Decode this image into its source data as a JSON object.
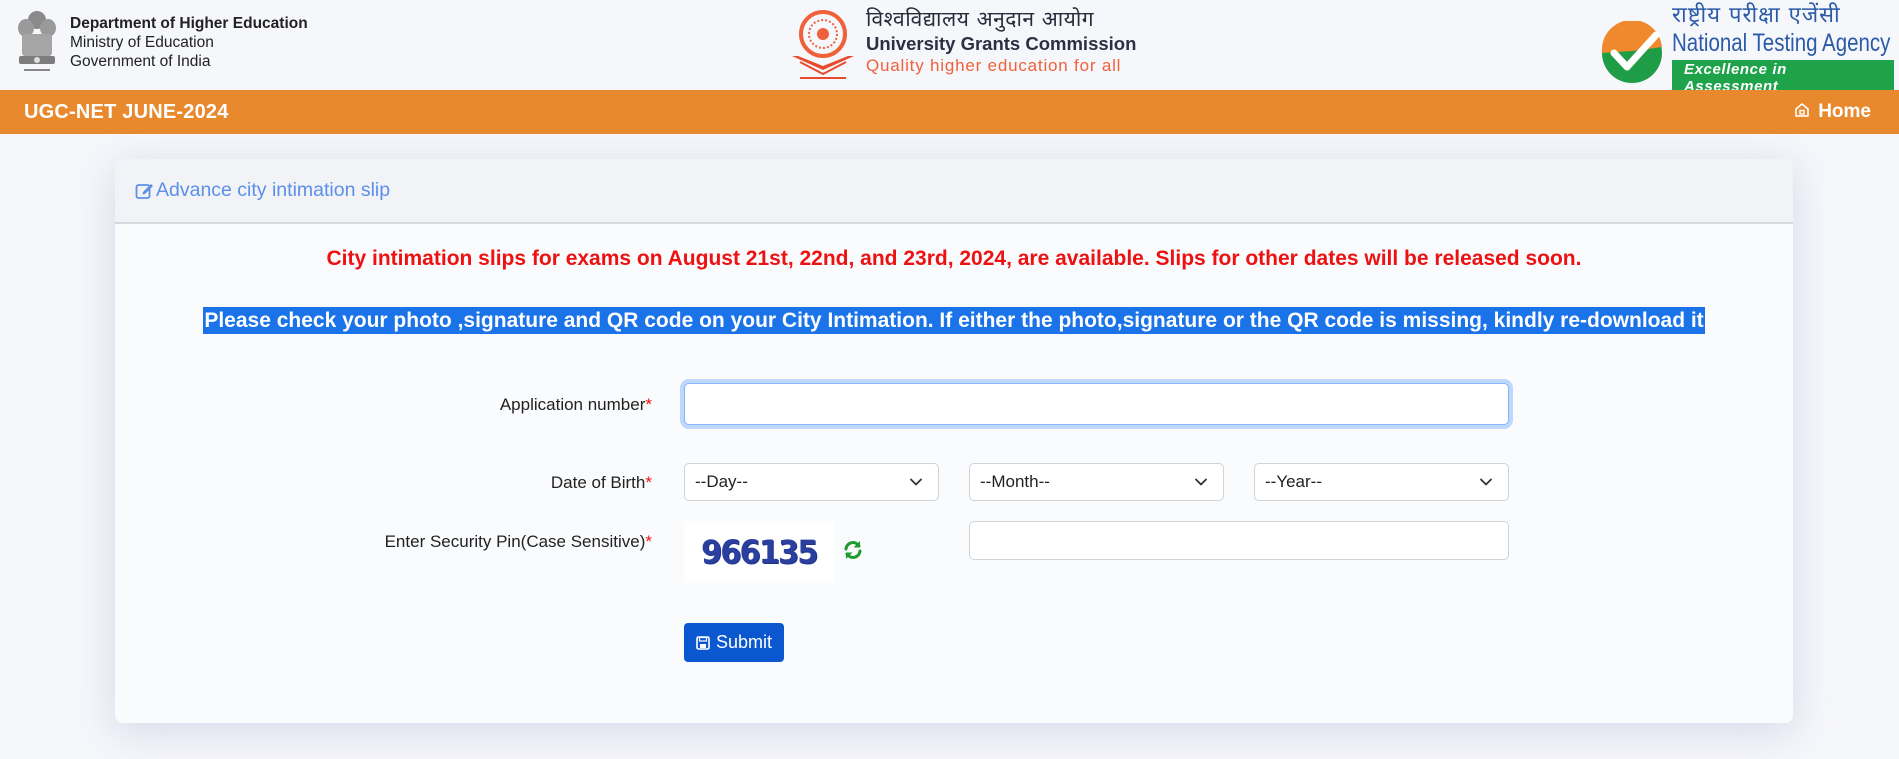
{
  "header": {
    "ministry": {
      "line1": "Department of Higher Education",
      "line2": "Ministry of Education",
      "line3": "Government of India",
      "emblem_icon": "ashoka-emblem-icon"
    },
    "ugc": {
      "hindi": "विश्वविद्यालय अनुदान आयोग",
      "english": "University Grants Commission",
      "tagline": "Quality higher education for all",
      "logo_icon": "ugc-chakra-logo-icon",
      "brand_color": "#f0613a"
    },
    "nta": {
      "hindi": "राष्ट्रीय परीक्षा एजेंसी",
      "english": "National Testing Agency",
      "tagline": "Excellence in Assessment",
      "logo_icon": "nta-check-logo-icon",
      "brand_color": "#2a5aa8",
      "tagline_color": "#1ea24a"
    }
  },
  "navbar": {
    "brand": "UGC-NET JUNE-2024",
    "home_label": "Home",
    "home_icon": "home-icon",
    "color": "#e8892e"
  },
  "card": {
    "title": "Advance city intimation slip",
    "title_icon": "edit-square-icon",
    "notice_red": "City intimation slips for exams on August 21st, 22nd, and 23rd, 2024, are available. Slips for other dates will be released soon.",
    "notice_selected": "Please check your photo ,signature and QR code on your City Intimation. If either the photo,signature or the QR code is missing, kindly re-download it"
  },
  "form": {
    "application_number": {
      "label": "Application number",
      "required_mark": "*",
      "value": "",
      "placeholder": ""
    },
    "dob": {
      "label": "Date of Birth",
      "required_mark": "*",
      "day": "--Day--",
      "month": "--Month--",
      "year": "--Year--"
    },
    "security_pin": {
      "label": "Enter Security Pin(Case Sensitive)",
      "required_mark": "*",
      "captcha_text": "966135",
      "refresh_icon": "refresh-icon",
      "value": ""
    },
    "submit_label": "Submit",
    "submit_icon": "save-icon"
  }
}
